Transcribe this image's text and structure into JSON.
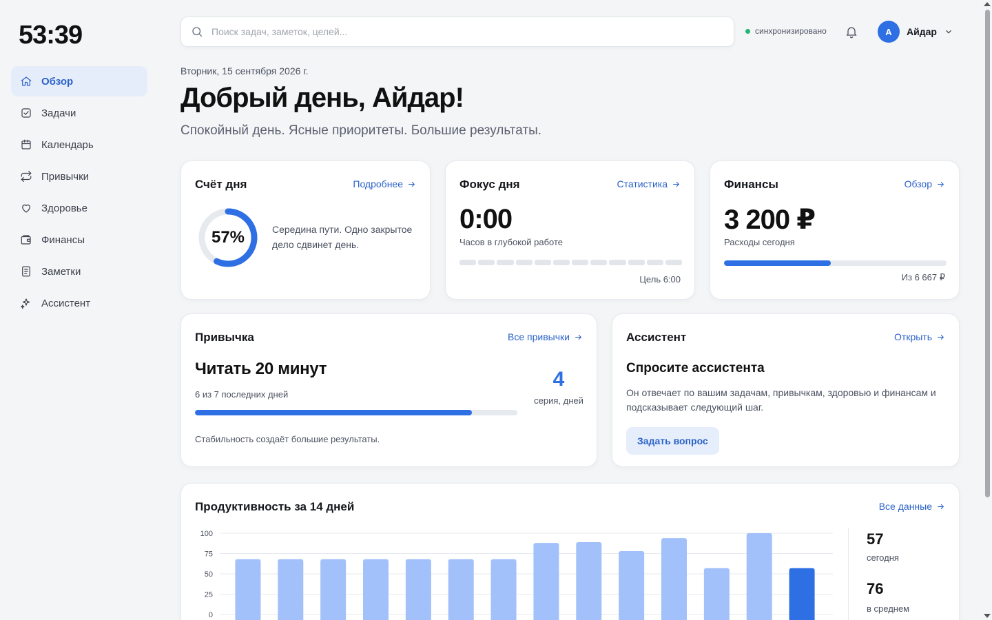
{
  "clock": "53:39",
  "nav": [
    {
      "label": "Обзор",
      "icon": "home-icon",
      "active": true
    },
    {
      "label": "Задачи",
      "icon": "checkbox-icon"
    },
    {
      "label": "Календарь",
      "icon": "calendar-icon"
    },
    {
      "label": "Привычки",
      "icon": "repeat-icon"
    },
    {
      "label": "Здоровье",
      "icon": "heart-icon"
    },
    {
      "label": "Финансы",
      "icon": "wallet-icon"
    },
    {
      "label": "Заметки",
      "icon": "note-icon"
    },
    {
      "label": "Ассистент",
      "icon": "sparkle-icon"
    }
  ],
  "search": {
    "placeholder": "Поиск задач, заметок, целей..."
  },
  "status": {
    "sync_label": "синхронизировано",
    "sync_color": "#22b573"
  },
  "user": {
    "initial": "A",
    "name": "Айдар"
  },
  "header": {
    "date": "Вторник, 15 сентября 2026 г.",
    "greeting": "Добрый день, Айдар!",
    "subtitle": "Спокойный день. Ясные приоритеты. Большие результаты."
  },
  "score": {
    "title": "Счёт дня",
    "link": "Подробнее",
    "percent_label": "57%",
    "percent": 57,
    "text": "Середина пути. Одно закрытое дело сдвинет день."
  },
  "focus": {
    "title": "Фокус дня",
    "link": "Статистика",
    "value": "0:00",
    "caption": "Часов в глубокой работе",
    "segments": 12,
    "segments_filled": 0,
    "goal": "Цель 6:00"
  },
  "finance": {
    "title": "Финансы",
    "link": "Обзор",
    "value": "3 200 ₽",
    "caption": "Расходы сегодня",
    "progress": 0.48,
    "limit": "Из 6 667 ₽"
  },
  "habit": {
    "title": "Привычка",
    "link": "Все привычки",
    "name": "Читать 20 минут",
    "sub": "6 из 7 последних дней",
    "progress": 0.86,
    "streak": "4",
    "streak_caption": "серия, дней",
    "footer": "Стабильность создаёт большие результаты."
  },
  "assistant": {
    "title": "Ассистент",
    "link": "Открыть",
    "heading": "Спросите ассистента",
    "text": "Он отвечает по вашим задачам, привычкам, здоровью и финансам и подсказывает следующий шаг.",
    "button": "Задать вопрос"
  },
  "productivity": {
    "title": "Продуктивность за 14 дней",
    "link": "Все данные",
    "today_value": "57",
    "today_caption": "сегодня",
    "avg_value": "76",
    "avg_caption": "в среднем"
  },
  "chart_data": {
    "type": "bar",
    "title": "Продуктивность за 14 дней",
    "categories": [],
    "values": [
      68,
      68,
      68,
      68,
      68,
      68,
      68,
      88,
      89,
      78,
      94,
      57,
      100,
      57
    ],
    "ylim": [
      0,
      100
    ],
    "yticks": [
      "100",
      "75",
      "50",
      "25",
      "0"
    ],
    "grid": true,
    "bar_color": "#a2c0fa",
    "highlight_color": "#2f6fe4",
    "highlight_index": 13
  }
}
